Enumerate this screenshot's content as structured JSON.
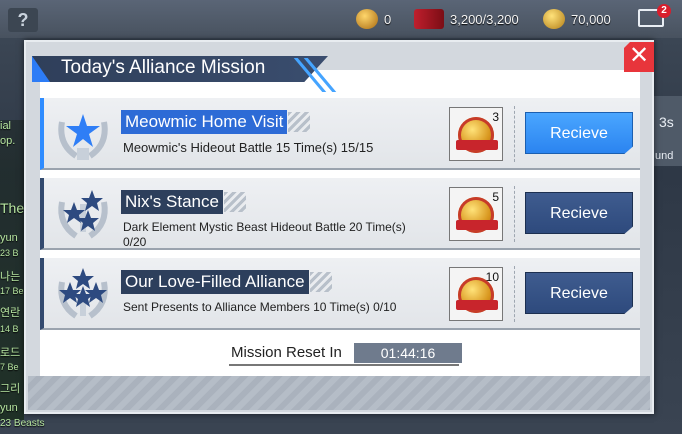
{
  "hud": {
    "help": "?",
    "coins": "0",
    "stamina": "3,200/3,200",
    "gold": "70,000",
    "mail_badge": "2"
  },
  "side": {
    "left_texts": [
      "ial",
      "op.",
      "The",
      "yun",
      "23 B",
      "나는",
      "17 Be",
      "연란",
      "14 B",
      "로드",
      "7 Be",
      "그리",
      "yun",
      "23 Beasts"
    ],
    "right_texts": [
      "3s",
      "und"
    ]
  },
  "modal": {
    "title": "Today's Alliance Mission",
    "close_symbol": "✕",
    "reset_label": "Mission Reset In",
    "reset_time": "01:44:16",
    "missions": [
      {
        "title": "Meowmic Home Visit",
        "desc_line1": "Meowmic's Hideout Battle 15 Time(s) 15/15",
        "desc_line2": "",
        "reward_count": "3",
        "button": "Recieve",
        "stars": 1
      },
      {
        "title": "Nix's Stance",
        "desc_line1": "Dark Element Mystic Beast Hideout Battle 20 Time(s)",
        "desc_line2": "0/20",
        "reward_count": "5",
        "button": "Recieve",
        "stars": 3
      },
      {
        "title": "Our Love-Filled Alliance",
        "desc_line1": "Sent Presents to Alliance Members 10 Time(s) 0/10",
        "desc_line2": "",
        "reward_count": "10",
        "button": "Recieve",
        "stars": 4
      }
    ]
  },
  "colors": {
    "accent_blue": "#2b84f0",
    "navy_button": "#2e4a7d",
    "close_red": "#e8353b"
  }
}
